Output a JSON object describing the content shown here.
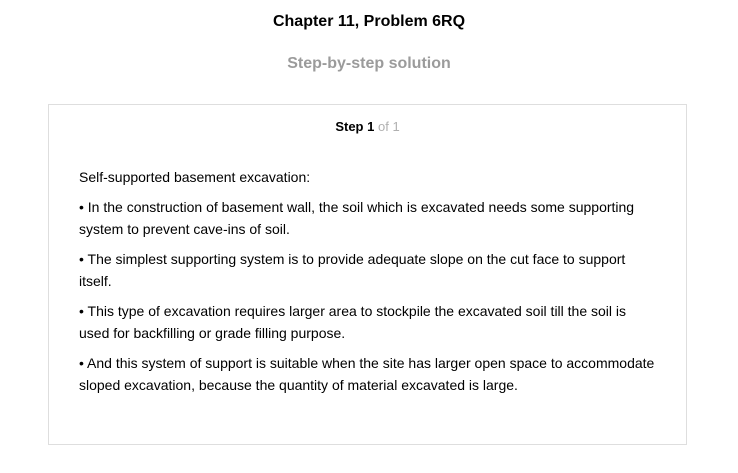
{
  "header": {
    "title": "Chapter 11, Problem 6RQ",
    "subtitle": "Step-by-step solution"
  },
  "step": {
    "label": "Step",
    "number": "1",
    "of_text": "of 1",
    "intro": "Self-supported basement excavation:",
    "bullets": [
      "• In the construction of basement wall, the soil which is excavated needs some supporting system to prevent cave-ins of soil.",
      "• The simplest supporting system is to provide adequate slope on the cut face to support itself.",
      "• This type of excavation requires larger area to stockpile the excavated soil till the soil is used for backfilling or grade filling purpose.",
      "• And this system of support is suitable when the site has larger open space to accommodate sloped excavation, because the quantity of material excavated is large."
    ]
  },
  "colors": {
    "subtitle": "#9b9b9b",
    "card_border": "#dedede",
    "step_of": "#b0b0b0"
  }
}
